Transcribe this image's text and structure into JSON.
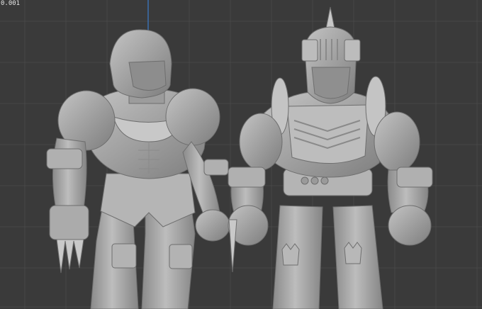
{
  "viewport": {
    "background": "#3a3a3a",
    "grid_color": "#474747",
    "axis_color": "#3b6fb0",
    "coordinate_readout": "0.001",
    "model_color": "#a7a7a7"
  },
  "scene": {
    "objects": [
      {
        "name": "helmeted-wrestler-figure",
        "details": [
          "full-face-helmet",
          "clawed-gauntlet",
          "knee-guards",
          "arm-bands"
        ]
      },
      {
        "name": "knight-armored-figure",
        "details": [
          "spiked-visor-helmet",
          "shoulder-discs",
          "chest-plate",
          "studded-belt",
          "spike-weapon"
        ]
      }
    ]
  }
}
